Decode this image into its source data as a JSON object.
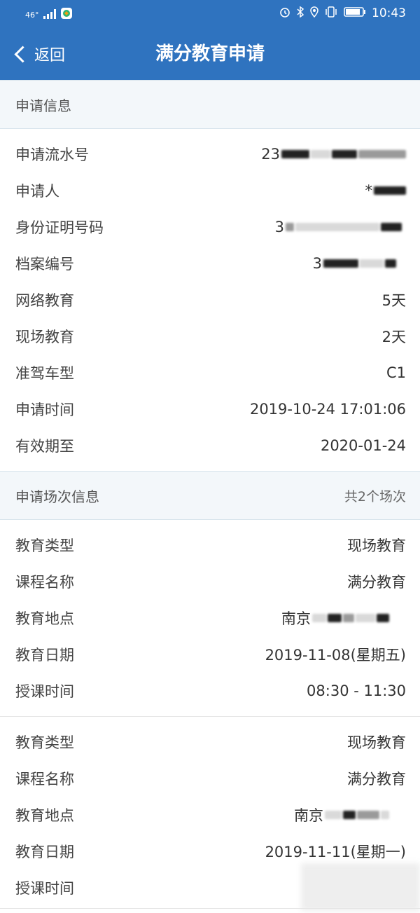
{
  "statusbar": {
    "network": "46°",
    "time": "10:43"
  },
  "nav": {
    "back_label": "返回",
    "title": "满分教育申请"
  },
  "application_info": {
    "section_title": "申请信息",
    "rows": [
      {
        "label": "申请流水号",
        "value": "23",
        "masked": true
      },
      {
        "label": "申请人",
        "value": "*",
        "masked": true
      },
      {
        "label": "身份证明号码",
        "value": "3",
        "masked": true
      },
      {
        "label": "档案编号",
        "value": "3",
        "masked": true
      },
      {
        "label": "网络教育",
        "value": "5天"
      },
      {
        "label": "现场教育",
        "value": "2天"
      },
      {
        "label": "准驾车型",
        "value": "C1"
      },
      {
        "label": "申请时间",
        "value": "2019-10-24 17:01:06"
      },
      {
        "label": "有效期至",
        "value": "2020-01-24"
      }
    ]
  },
  "session_info": {
    "section_title": "申请场次信息",
    "count_label": "共2个场次",
    "sessions": [
      {
        "rows": [
          {
            "label": "教育类型",
            "value": "现场教育"
          },
          {
            "label": "课程名称",
            "value": "满分教育"
          },
          {
            "label": "教育地点",
            "value": "南京",
            "masked": true
          },
          {
            "label": "教育日期",
            "value": "2019-11-08(星期五)"
          },
          {
            "label": "授课时间",
            "value": "08:30 - 11:30"
          }
        ]
      },
      {
        "rows": [
          {
            "label": "教育类型",
            "value": "现场教育"
          },
          {
            "label": "课程名称",
            "value": "满分教育"
          },
          {
            "label": "教育地点",
            "value": "南京",
            "masked": true
          },
          {
            "label": "教育日期",
            "value": "2019-11-11(星期一)"
          },
          {
            "label": "授课时间",
            "value": ""
          }
        ]
      }
    ]
  }
}
